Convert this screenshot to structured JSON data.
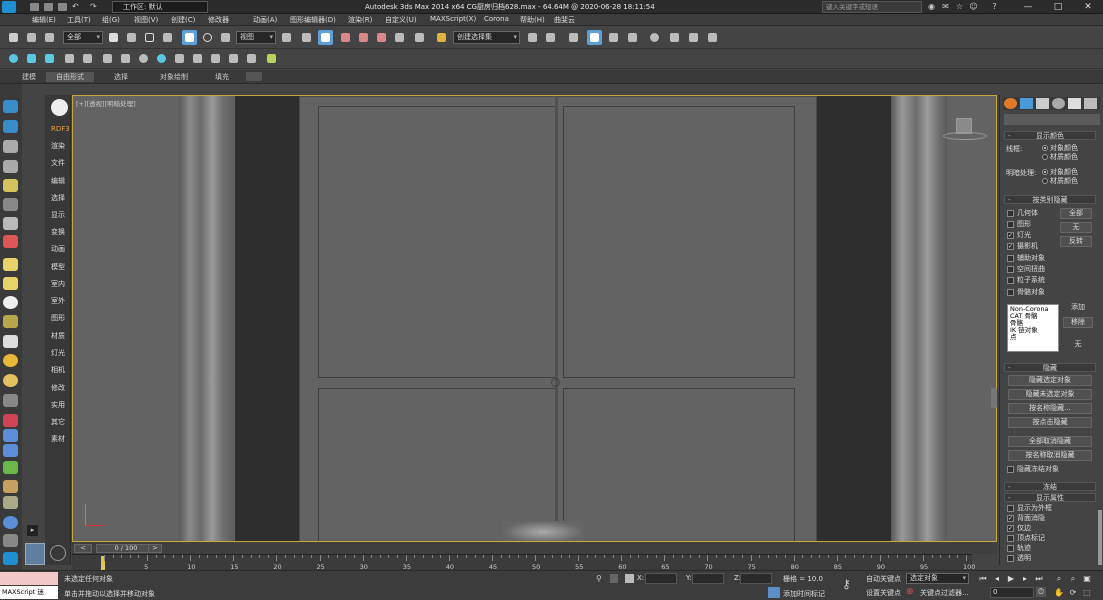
{
  "titlebar": {
    "workspace": "工作区: 默认",
    "title": "Autodesk 3ds Max  2014 x64      CG厨房归档628.max - 64.64M @ 2020-06-28 18:11:54",
    "search_placeholder": "键入关键字或短语",
    "min": "—",
    "max": "□",
    "close": "✕"
  },
  "menu": [
    "编辑(E)",
    "工具(T)",
    "组(G)",
    "视图(V)",
    "创建(C)",
    "修改器",
    "动画(A)",
    "图形编辑器(D)",
    "渲染(R)",
    "自定义(U)",
    "MAXScript(X)",
    "Corona",
    "帮助(H)",
    "曲斐云"
  ],
  "toolbar": {
    "filter_select": "全部",
    "refcoord_select": "视图",
    "selset_select": "创建选择集"
  },
  "ribbon": {
    "tabs": [
      "建模",
      "自由形式",
      "选择",
      "对象绘制",
      "填充"
    ]
  },
  "leftpanel": {
    "items": [
      "RDF3",
      "渲染",
      "文件",
      "编辑",
      "选择",
      "显示",
      "变换",
      "动画",
      "模型",
      "室内",
      "室外",
      "图形",
      "材质",
      "灯光",
      "相机",
      "修改",
      "实用",
      "其它",
      "素材"
    ]
  },
  "viewport": {
    "label": "[+][透视][明暗处理]"
  },
  "rightpanel": {
    "display_color": {
      "header": "显示颜色",
      "wire_label": "线框:",
      "shaded_label": "明暗处理:",
      "opt_object": "对象颜色",
      "opt_material": "材质颜色"
    },
    "hide_by_category": {
      "header": "按类别隐藏",
      "items": [
        {
          "label": "几何体",
          "checked": false
        },
        {
          "label": "图形",
          "checked": false
        },
        {
          "label": "灯光",
          "checked": true
        },
        {
          "label": "摄影机",
          "checked": true
        },
        {
          "label": "辅助对象",
          "checked": false
        },
        {
          "label": "空间扭曲",
          "checked": false
        },
        {
          "label": "粒子系统",
          "checked": false
        },
        {
          "label": "骨骼对象",
          "checked": false
        }
      ],
      "btn_all": "全部",
      "btn_none": "无",
      "btn_invert": "反转",
      "list": [
        "Non-Corona",
        "CAT 骨骼",
        "骨骼",
        "IK 链对象",
        "点"
      ],
      "btn_add": "添加",
      "btn_remove": "移除",
      "btn_none2": "无"
    },
    "hide": {
      "header": "隐藏",
      "buttons": [
        "隐藏选定对象",
        "隐藏未选定对象",
        "按名称隐藏...",
        "按点击隐藏",
        "全部取消隐藏",
        "按名称取消隐藏"
      ],
      "freeze_hidden": "隐藏冻结对象"
    },
    "freeze": {
      "header": "冻结"
    },
    "display_props": {
      "header": "显示属性",
      "items": [
        {
          "label": "显示为外框",
          "checked": false
        },
        {
          "label": "背面消隐",
          "checked": true
        },
        {
          "label": "仅边",
          "checked": true
        },
        {
          "label": "顶点标记",
          "checked": false
        },
        {
          "label": "轨迹",
          "checked": false
        },
        {
          "label": "透明",
          "checked": false
        }
      ]
    }
  },
  "timeline": {
    "frame_display": "0 / 100",
    "ticks": [
      "0",
      "5",
      "10",
      "15",
      "20",
      "25",
      "30",
      "35",
      "40",
      "45",
      "50",
      "55",
      "60",
      "65",
      "70",
      "75",
      "80",
      "85",
      "90",
      "95",
      "100"
    ]
  },
  "status": {
    "maxscript_label": "MAXScript 迷",
    "selection": "未选定任何对象",
    "prompt": "单击并拖动以选择并移动对象",
    "x_label": "X:",
    "y_label": "Y:",
    "z_label": "Z:",
    "grid": "栅格 = 10.0",
    "autokey": "自动关键点",
    "setkey": "设置关键点",
    "key_filter_select": "选定对象",
    "key_filters": "关键点过滤器...",
    "add_time_tag": "添加时间标记",
    "frame_field": "0"
  }
}
